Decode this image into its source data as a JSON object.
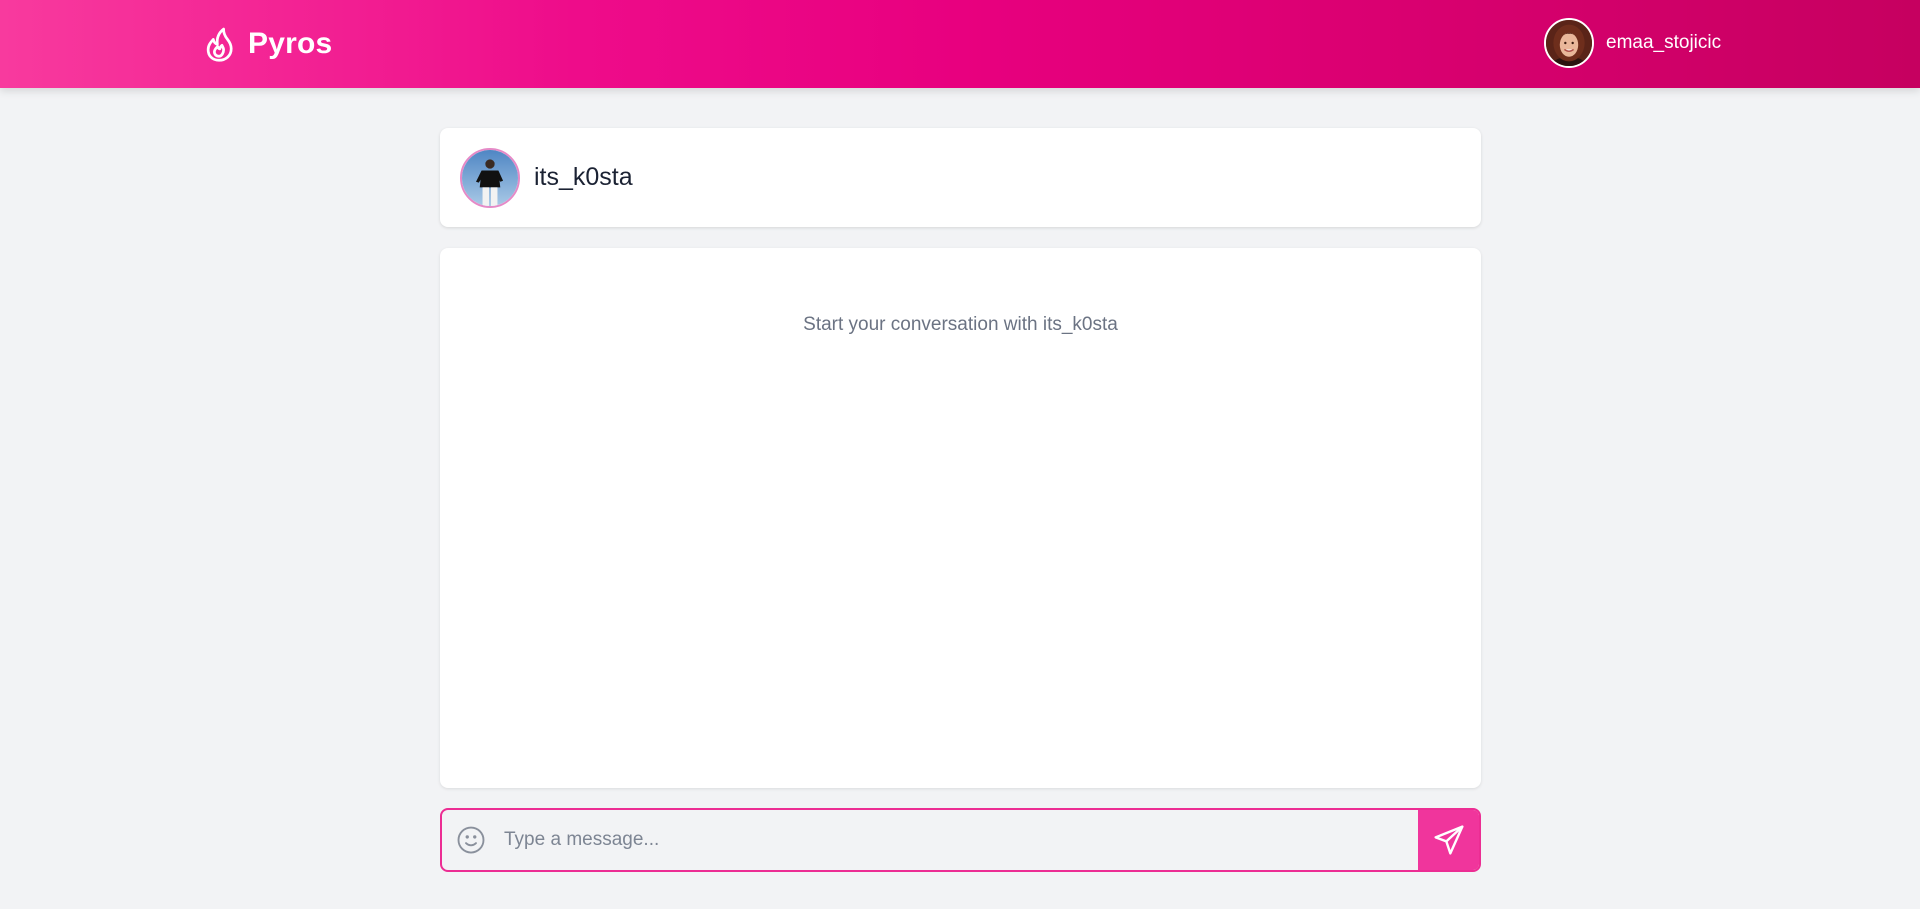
{
  "app": {
    "brand_name": "Pyros",
    "brand_icon": "flame-icon",
    "colors": {
      "header_gradient_start": "#f83a9e",
      "header_gradient_end": "#c60060",
      "accent": "#ec2d93",
      "page_background": "#f2f3f5"
    }
  },
  "current_user": {
    "username": "emaa_stojicic",
    "avatar": "user-avatar"
  },
  "conversation": {
    "contact_username": "its_k0sta",
    "contact_avatar": "contact-avatar",
    "empty_message": "Start your conversation with its_k0sta"
  },
  "composer": {
    "placeholder": "Type a message...",
    "value": "",
    "emoji_icon": "smiley-icon",
    "send_icon": "send-icon"
  }
}
